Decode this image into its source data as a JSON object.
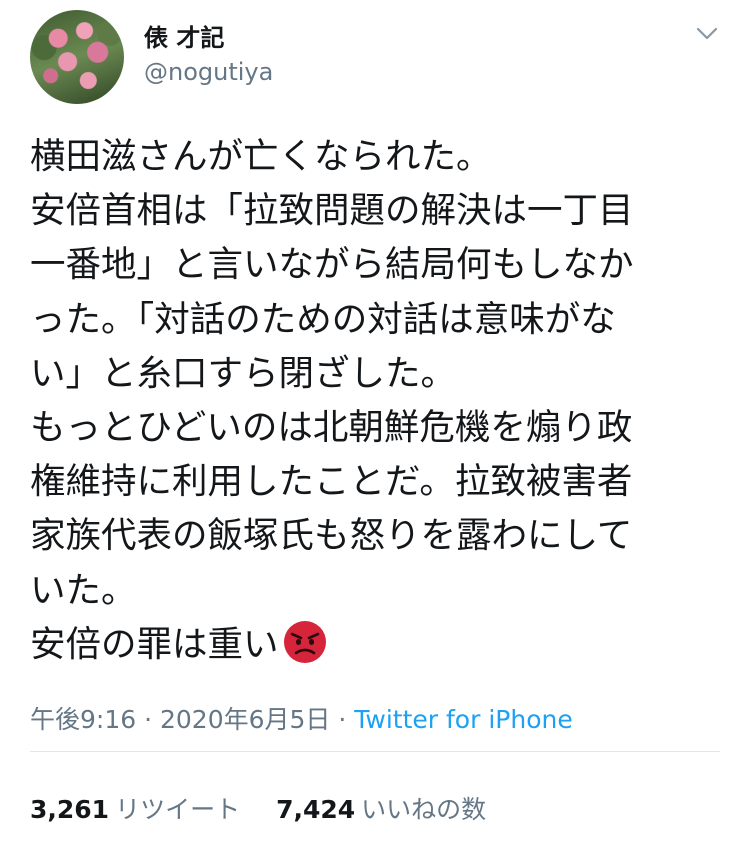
{
  "user": {
    "display_name": "俵 才記",
    "handle": "@nogutiya"
  },
  "tweet": {
    "lines": [
      "横田滋さんが亡くなられた。",
      "安倍首相は「拉致問題の解決は一丁目",
      "一番地」と言いながら結局何もしなか",
      "った。「対話のための対話は意味がな",
      "い」と糸口すら閉ざした。",
      "もっとひどいのは北朝鮮危機を煽り政",
      "権維持に利用したことだ。拉致被害者",
      "家族代表の飯塚氏も怒りを露わにして",
      "いた。",
      "安倍の罪は重い"
    ],
    "emoji": "pouting-face"
  },
  "meta": {
    "time": "午後9:16",
    "sep1": " · ",
    "date": "2020年6月5日",
    "sep2": " · ",
    "source": "Twitter for iPhone"
  },
  "stats": {
    "retweets_count": "3,261",
    "retweets_label": "リツイート",
    "likes_count": "7,424",
    "likes_label": "いいねの数"
  },
  "colors": {
    "text": "#14171a",
    "secondary": "#657786",
    "link": "#1da1f2",
    "divider": "#e1e8ed",
    "emoji": "#d6243a"
  }
}
